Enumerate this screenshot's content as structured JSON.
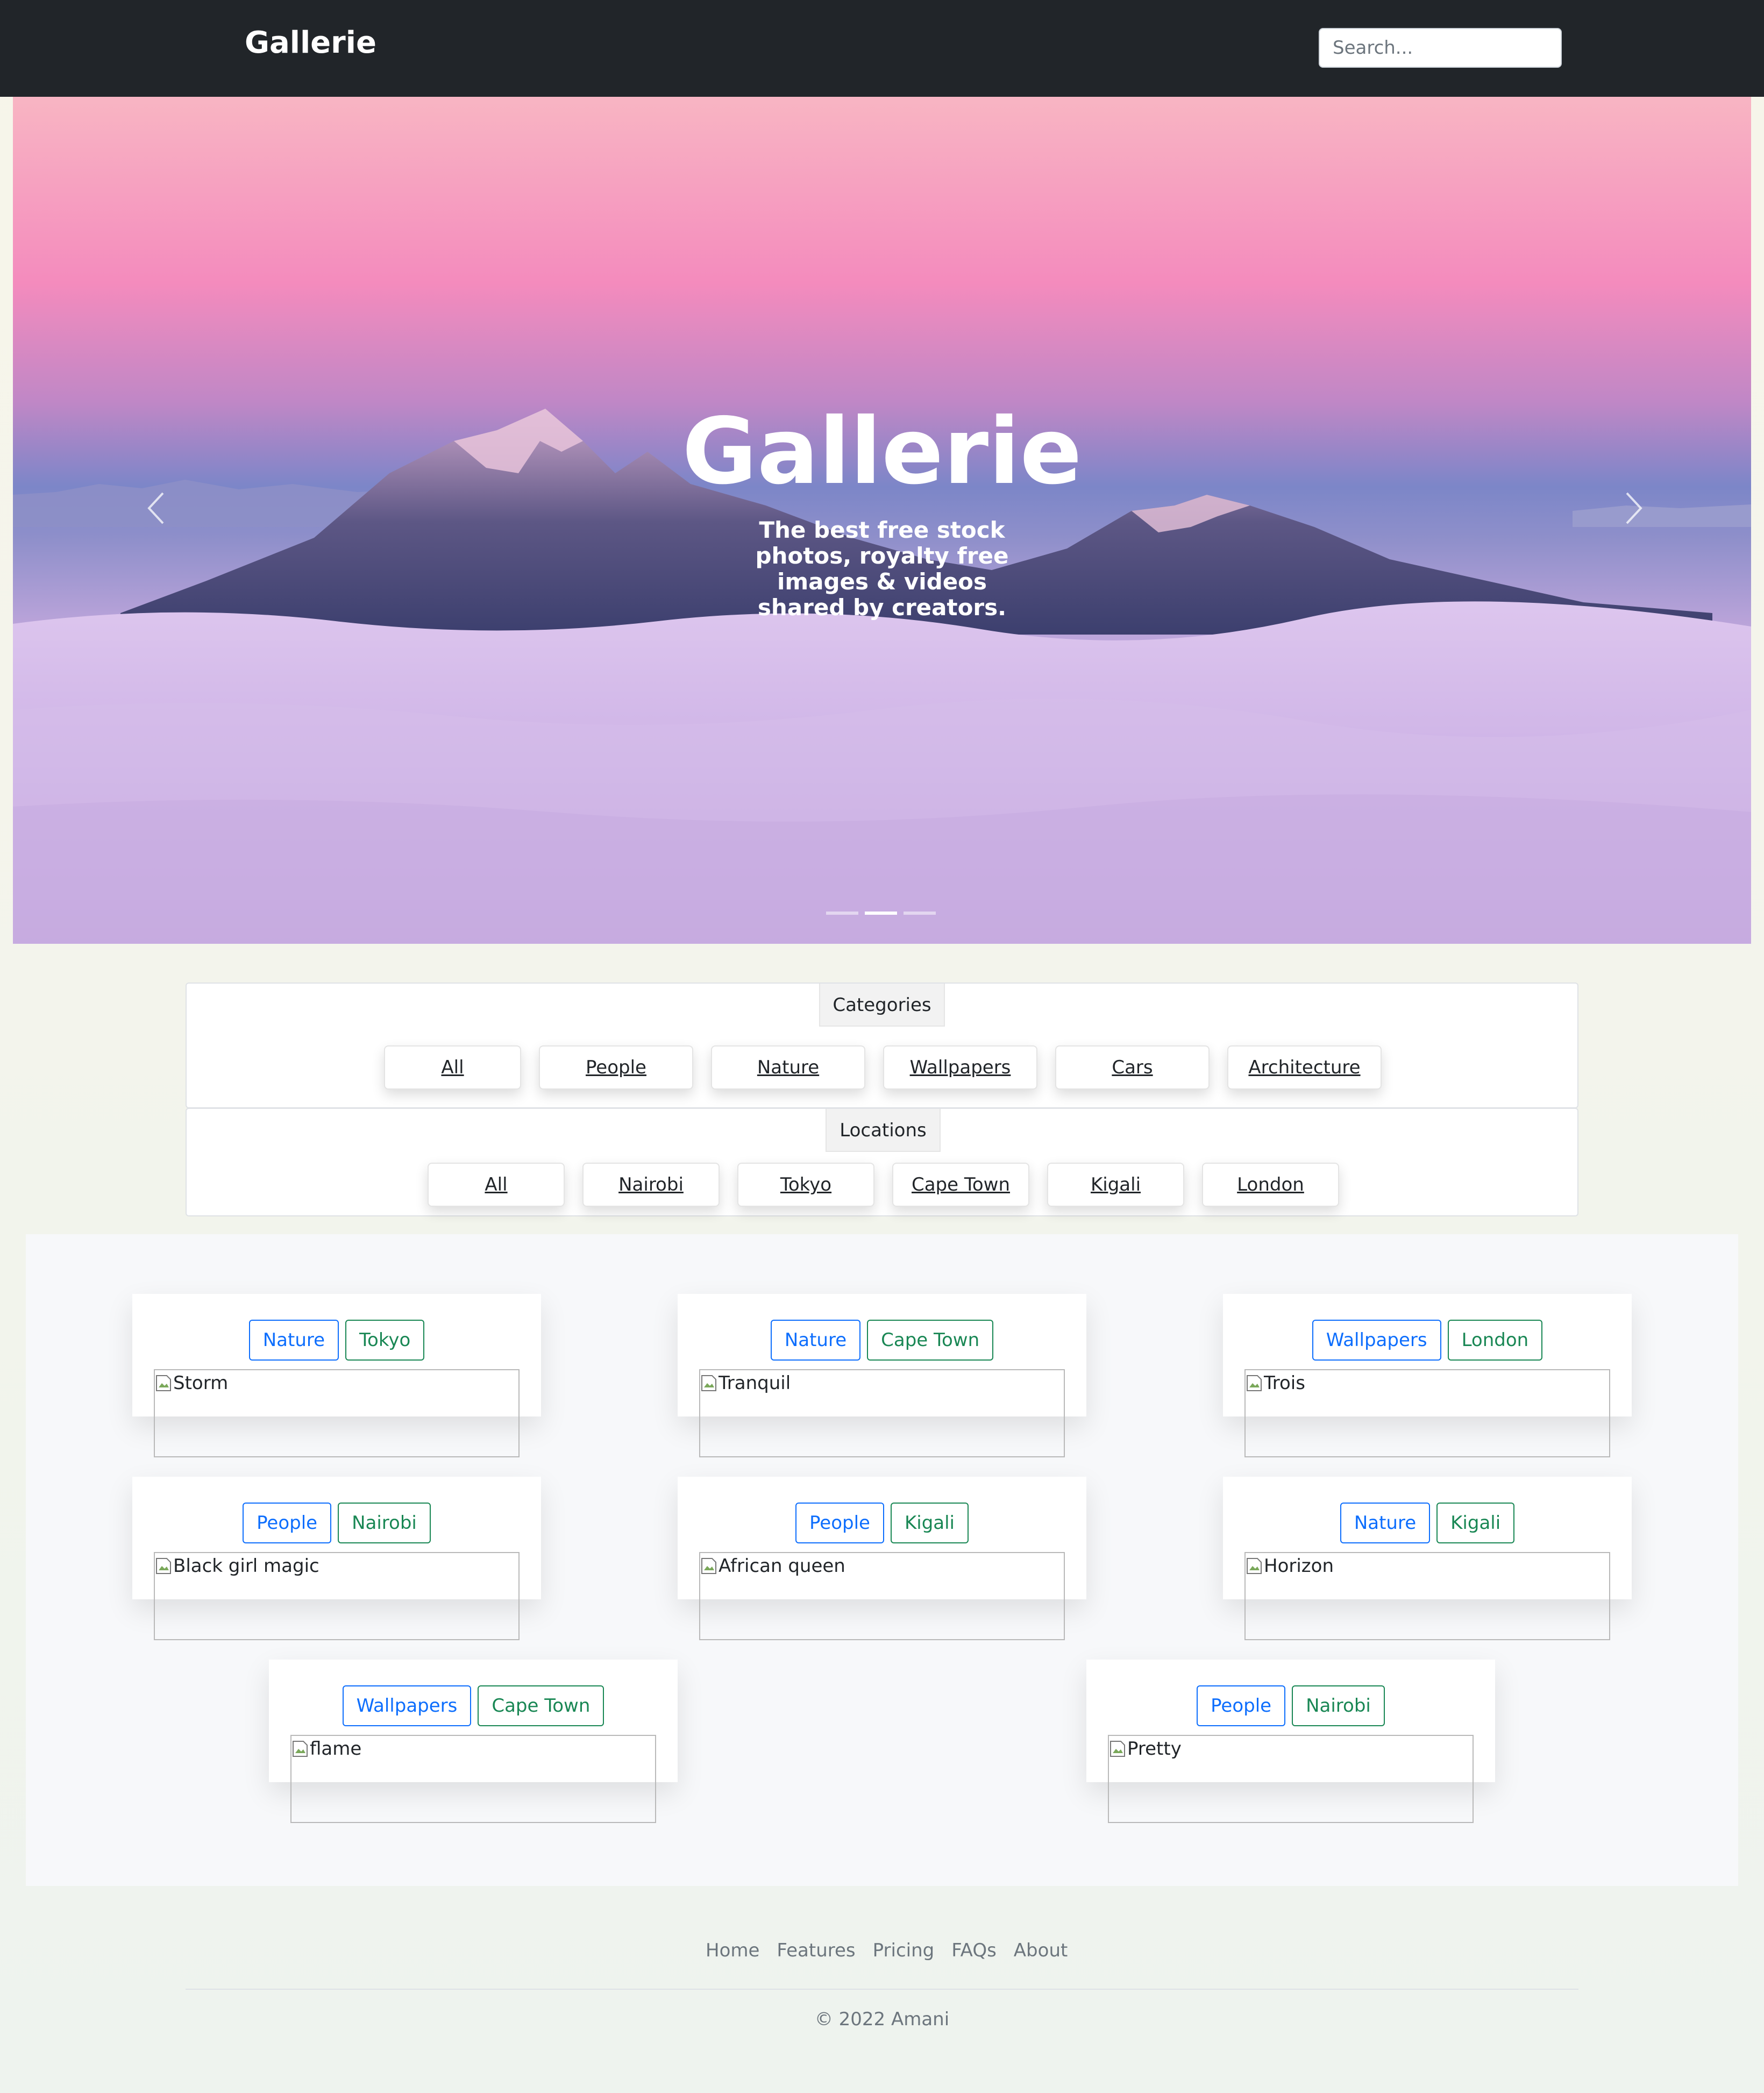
{
  "navbar": {
    "brand": "Gallerie",
    "search_placeholder": "Search..."
  },
  "hero": {
    "title": "Gallerie",
    "subtitle": "The best free stock photos, royalty free images & videos shared by creators.",
    "prev_icon": "chevron-left-icon",
    "next_icon": "chevron-right-icon",
    "slide_count": 3,
    "active_slide": 2
  },
  "categories": {
    "heading": "Categories",
    "items": [
      "All",
      "People",
      "Nature",
      "Wallpapers",
      "Cars",
      "Architecture"
    ]
  },
  "locations": {
    "heading": "Locations",
    "items": [
      "All",
      "Nairobi",
      "Tokyo",
      "Cape Town",
      "Kigali",
      "London"
    ]
  },
  "photos": [
    {
      "category": "Nature",
      "location": "Tokyo",
      "alt": "Storm"
    },
    {
      "category": "Nature",
      "location": "Cape Town",
      "alt": "Tranquil"
    },
    {
      "category": "Wallpapers",
      "location": "London",
      "alt": "Trois"
    },
    {
      "category": "People",
      "location": "Nairobi",
      "alt": "Black girl magic"
    },
    {
      "category": "People",
      "location": "Kigali",
      "alt": "African queen"
    },
    {
      "category": "Nature",
      "location": "Kigali",
      "alt": "Horizon"
    },
    {
      "category": "Wallpapers",
      "location": "Cape Town",
      "alt": "flame"
    },
    {
      "category": "People",
      "location": "Nairobi",
      "alt": "Pretty"
    }
  ],
  "footer": {
    "links": [
      "Home",
      "Features",
      "Pricing",
      "FAQs",
      "About"
    ],
    "copyright": "© 2022 Amani"
  },
  "colors": {
    "navbar": "#212529",
    "category_tag": "#0d6efd",
    "location_tag": "#198754"
  }
}
